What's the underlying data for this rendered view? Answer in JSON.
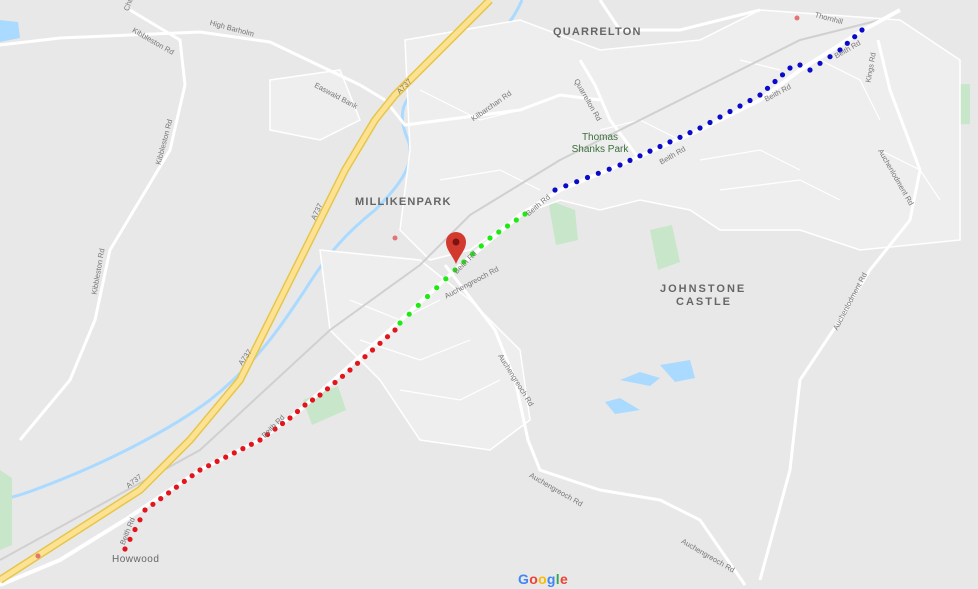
{
  "map": {
    "places": {
      "quarrelton": "QUARRELTON",
      "millikenpark": "MILLIKENPARK",
      "johnstone_castle_1": "JOHNSTONE",
      "johnstone_castle_2": "CASTLE",
      "howwood": "Howwood"
    },
    "park": {
      "line1": "Thomas",
      "line2": "Shanks Park"
    },
    "roads": {
      "a737_1": "A737",
      "a737_2": "A737",
      "a737_3": "A737",
      "a737_4": "A737",
      "beith_1": "Beith Rd",
      "beith_2": "Beith Rd",
      "beith_3": "Beith Rd",
      "beith_4": "Beith Rd",
      "beith_5": "Beith Rd",
      "beith_6": "Beith Rd",
      "beith_7": "Beith Rd",
      "kibbleston_1": "Kibbleston Rd",
      "kibbleston_2": "Kibbleston Rd",
      "kibbleston_3": "Kibbleston Rd",
      "auchengreoch_1": "Auchengreoch Rd",
      "auchengreoch_2": "Auchengreoch Rd",
      "auchengreoch_3": "Auchengreoch Rd",
      "auchengreoch_4": "Auchengreoch Rd",
      "auchenlodment_1": "Auchenlodment Rd",
      "auchenlodment_2": "Auchenlodment Rd",
      "kilbarchan": "Kilbarchan Rd",
      "quarrelton_rd": "Quarrelton Rd",
      "easwald": "Easwald Bank",
      "high_barholm": "High Barholm",
      "thornhill": "Thornhill",
      "kings": "Kings Rd",
      "church": "Church St"
    },
    "route_colors": {
      "red": "#e3141b",
      "green": "#1dea10",
      "blue": "#0a0ac8"
    },
    "marker_color": "#d33a2f",
    "logo": [
      "G",
      "o",
      "o",
      "g",
      "l",
      "e"
    ]
  }
}
